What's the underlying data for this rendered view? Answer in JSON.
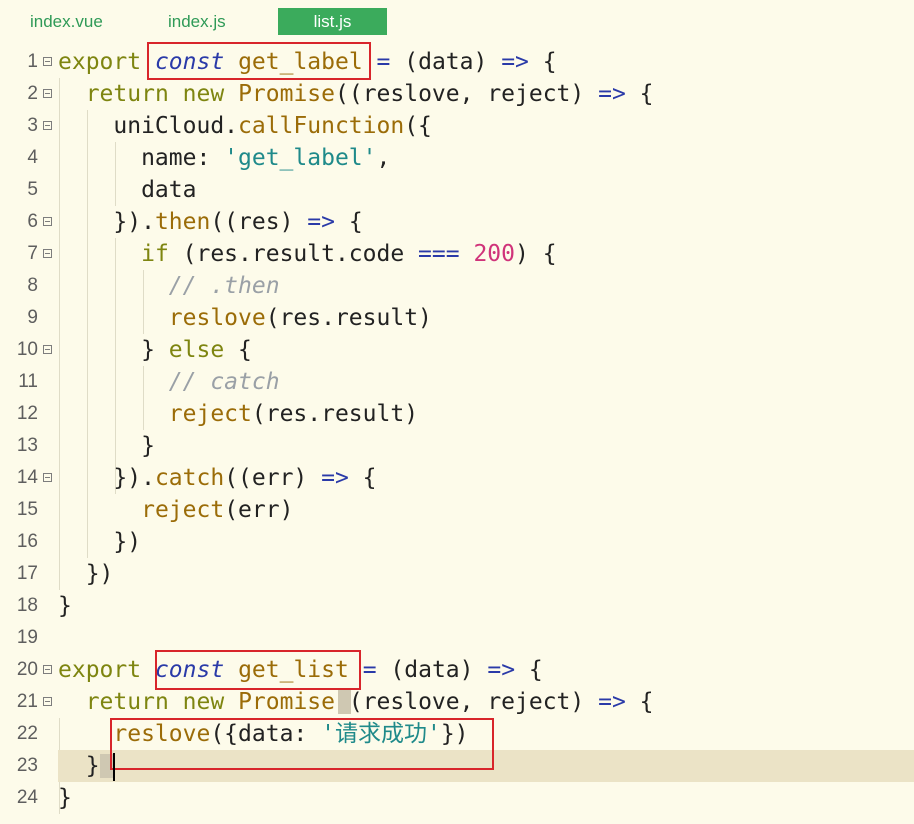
{
  "tabs": [
    {
      "label": "index.vue",
      "active": false
    },
    {
      "label": "index.js",
      "active": false
    },
    {
      "label": "list.js",
      "active": true
    }
  ],
  "lines": [
    {
      "n": "1",
      "fold": true,
      "html": "<span class='kw'>export</span> <span class='kw2'>const</span> <span class='fn'>get_label</span> <span class='op'>=</span> (data) <span class='op'>=&gt;</span> {"
    },
    {
      "n": "2",
      "fold": true,
      "html": "  <span class='kw'>return</span> <span class='kw'>new</span> <span class='fn'>Promise</span>((reslove, reject) <span class='op'>=&gt;</span> {"
    },
    {
      "n": "3",
      "fold": true,
      "html": "    uniCloud.<span class='fn'>callFunction</span>({"
    },
    {
      "n": "4",
      "fold": false,
      "html": "      name: <span class='str'>'get_label'</span>,"
    },
    {
      "n": "5",
      "fold": false,
      "html": "      data"
    },
    {
      "n": "6",
      "fold": true,
      "html": "    }).<span class='fn'>then</span>((res) <span class='op'>=&gt;</span> {"
    },
    {
      "n": "7",
      "fold": true,
      "html": "      <span class='kw'>if</span> (res.result.code <span class='op'>===</span> <span class='num'>200</span>) {"
    },
    {
      "n": "8",
      "fold": false,
      "html": "        <span class='cm'>// .then</span>"
    },
    {
      "n": "9",
      "fold": false,
      "html": "        <span class='fn'>reslove</span>(res.result)"
    },
    {
      "n": "10",
      "fold": true,
      "html": "      } <span class='kw'>else</span> {"
    },
    {
      "n": "11",
      "fold": false,
      "html": "        <span class='cm'>// catch</span>"
    },
    {
      "n": "12",
      "fold": false,
      "html": "        <span class='fn'>reject</span>(res.result)"
    },
    {
      "n": "13",
      "fold": false,
      "html": "      }"
    },
    {
      "n": "14",
      "fold": true,
      "html": "    }).<span class='fn'>catch</span>((err) <span class='op'>=&gt;</span> {"
    },
    {
      "n": "15",
      "fold": false,
      "html": "      <span class='fn'>reject</span>(err)"
    },
    {
      "n": "16",
      "fold": false,
      "html": "    })"
    },
    {
      "n": "17",
      "fold": false,
      "html": "  })"
    },
    {
      "n": "18",
      "fold": false,
      "html": "}"
    },
    {
      "n": "19",
      "fold": false,
      "html": ""
    },
    {
      "n": "20",
      "fold": true,
      "html": "<span class='kw'>export</span> <span class='kw2'>const</span> <span class='fn'>get_list</span> <span class='op'>=</span> (data) <span class='op'>=&gt;</span> {"
    },
    {
      "n": "21",
      "fold": true,
      "html": "  <span class='kw'>return</span> <span class='kw'>new</span> <span class='fn'>Promise</span>((reslove, reject) <span class='op'>=&gt;</span> {"
    },
    {
      "n": "22",
      "fold": false,
      "html": "    <span class='fn'>reslove</span>({data: <span class='str'>'请求成功'</span>})"
    },
    {
      "n": "23",
      "fold": false,
      "html": "  })"
    },
    {
      "n": "24",
      "fold": false,
      "html": "}"
    }
  ],
  "colors": {
    "background": "#fdfbea",
    "active_tab": "#3bab5c",
    "highlight_box": "#d8252b",
    "current_line": "#ebe3c6"
  }
}
